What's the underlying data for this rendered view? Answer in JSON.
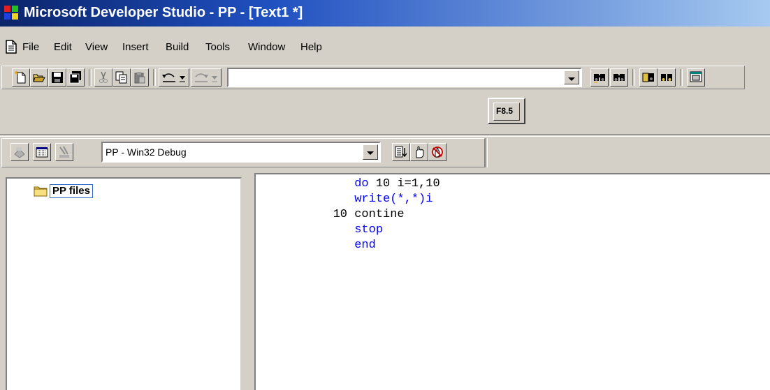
{
  "window": {
    "title": "Microsoft Developer Studio - PP - [Text1 *]"
  },
  "menu": [
    "File",
    "Edit",
    "View",
    "Insert",
    "Build",
    "Tools",
    "Window",
    "Help"
  ],
  "toolbar": {
    "find_combo_value": "",
    "fortran_button_label": "F8.5",
    "config_combo_value": "PP - Win32 Debug"
  },
  "workspace": {
    "root_label": "PP files"
  },
  "editor": {
    "keyword_color": "#0000ff",
    "lines": [
      {
        "label": "",
        "code": "do 10 i=1,10",
        "keyword": true
      },
      {
        "label": "",
        "code": "write(*,*)i",
        "keyword": true
      },
      {
        "label": "10",
        "code": "contine",
        "keyword": false
      },
      {
        "label": "",
        "code": "stop",
        "keyword": true
      },
      {
        "label": "",
        "code": "end",
        "keyword": true
      }
    ]
  },
  "icons": [
    "app-icon",
    "document-icon",
    "new-file-icon",
    "open-folder-icon",
    "save-icon",
    "save-all-icon",
    "cut-icon",
    "copy-icon",
    "paste-icon",
    "undo-icon",
    "redo-icon",
    "find-in-files-icon",
    "replace-icon",
    "workspace-icon",
    "output-icon",
    "window-list-icon",
    "compile-icon",
    "build-icon",
    "stop-build-icon",
    "go-icon",
    "breakpoint-icon",
    "remove-breakpoints-icon",
    "folder-icon"
  ]
}
